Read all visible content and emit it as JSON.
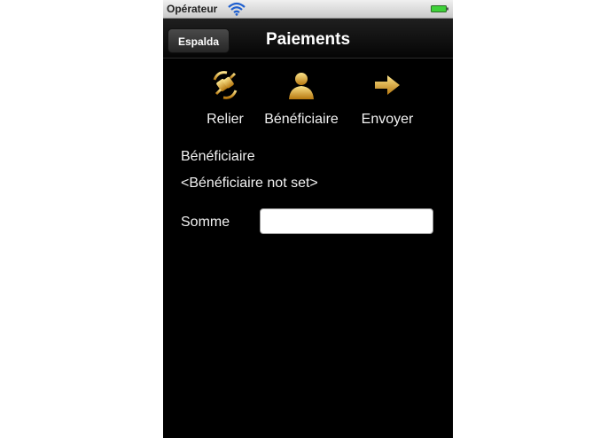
{
  "status_bar": {
    "carrier": "Opérateur",
    "icons": [
      "wifi-icon",
      "battery-icon"
    ],
    "battery_color": "#3fd13a"
  },
  "nav_bar": {
    "back_label": "Espalda",
    "title": "Paiements"
  },
  "tabs": [
    {
      "label": "Relier",
      "icon": "plug-connect-icon"
    },
    {
      "label": "Bénéficiaire",
      "icon": "person-icon"
    },
    {
      "label": "Envoyer",
      "icon": "arrow-right-icon"
    }
  ],
  "beneficiary": {
    "label": "Bénéficiaire",
    "value": "<Bénéficiaire not set>"
  },
  "amount": {
    "label": "Somme",
    "value": "",
    "placeholder": ""
  },
  "colors": {
    "background": "#000000",
    "icon_gold": "#d9a21b",
    "text": "#f2f2f2"
  }
}
